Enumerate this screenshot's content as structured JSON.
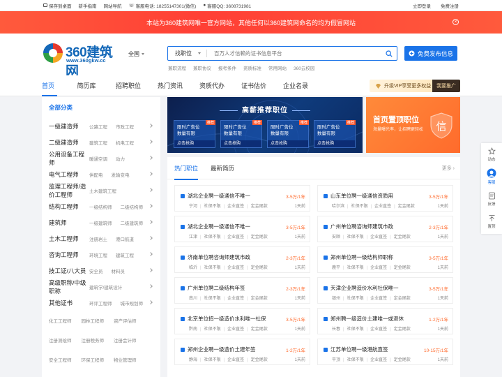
{
  "topbar": {
    "save_desktop": "保存到桌面",
    "newbie": "新手指南",
    "site_nav": "网站导航",
    "service_phone": "客服电话: 18255147301(微信)",
    "service_qq": "客服QQ: 3608731981",
    "login": "立即登录",
    "register": "免费注册"
  },
  "banner": {
    "text": "本站为360建筑网唯一官方网站，其他任何以360建筑网命名的均为假冒网站",
    "close": "×"
  },
  "header": {
    "logo_text": "360建筑网",
    "logo_sub": "www.360gkw.cc",
    "city": "全国",
    "search_select": "找职位",
    "search_placeholder": "百万人才信赖的证书信息平台",
    "publish_label": "免费发布信息",
    "hotlinks": [
      "兼职流程",
      "兼职协议",
      "报考条件",
      "资质标准",
      "常用网站",
      "360云校园"
    ]
  },
  "nav": {
    "items": [
      "首页",
      "简历库",
      "招聘职位",
      "热门资讯",
      "资质代办",
      "证书估价",
      "企业名录"
    ],
    "vip_text": "升级VIP享受更多权益",
    "vip_button": "我要推广"
  },
  "categories": {
    "title": "全部分类",
    "rows": [
      {
        "main": "一级建造师",
        "subs": [
          "公路工程",
          "市政工程"
        ]
      },
      {
        "main": "二级建造师",
        "subs": [
          "建筑工程",
          "机电工程"
        ]
      },
      {
        "main": "公用设备工程师",
        "subs": [
          "暖通空调",
          "动力"
        ]
      },
      {
        "main": "电气工程师",
        "subs": [
          "供配电",
          "发输变电"
        ]
      },
      {
        "main": "监理工程师/造价工程师",
        "subs": [
          "土木建筑工程"
        ]
      },
      {
        "main": "结构工程师",
        "subs": [
          "一级结构师",
          "二级结构师"
        ]
      },
      {
        "main": "建筑师",
        "subs": [
          "一级建筑师",
          "二级建筑师"
        ]
      },
      {
        "main": "土木工程师",
        "subs": [
          "注册岩土",
          "港口航道"
        ]
      },
      {
        "main": "咨询工程师",
        "subs": [
          "环境工程",
          "建筑工程"
        ]
      },
      {
        "main": "技工证/八大员",
        "subs": [
          "安全员",
          "材料员"
        ]
      },
      {
        "main": "高级职称/中级职称",
        "subs": [
          "建筑学/建筑设计"
        ]
      },
      {
        "main": "其他证书",
        "subs": [
          "环评工程师",
          "城市规划师"
        ]
      }
    ],
    "extra_rows": [
      [
        "化工工程师",
        "园林工程师",
        "资产评估师"
      ],
      [
        "注册测绘师",
        "注册税务师",
        "注册会计师"
      ],
      [
        "安全工程师",
        "环保工程师",
        "物业管理师"
      ]
    ]
  },
  "promo": {
    "title": "高薪推荐职位",
    "cards": [
      {
        "line1": "限时广告位",
        "line2": "数量有限",
        "btn": "点击抢购",
        "tag": "推荐"
      },
      {
        "line1": "限时广告位",
        "line2": "数量有限",
        "btn": "点击抢购",
        "tag": "推荐"
      },
      {
        "line1": "限时广告位",
        "line2": "数量有限",
        "btn": "点击抢购",
        "tag": "推荐"
      },
      {
        "line1": "限时广告位",
        "line2": "数量有限",
        "btn": "点击抢购",
        "tag": "推荐"
      }
    ],
    "top_title": "首页置顶职位",
    "top_sub": "海量曝光率，让招聘更轻松",
    "top_badge": "信"
  },
  "jobs": {
    "tab_hot": "热门职位",
    "tab_new": "最新简历",
    "more": "更多 ›",
    "list": [
      {
        "title": "湖北企业聘一级通信不唯一",
        "salary": "3-5万/1年",
        "meta": [
          "宁河",
          "社保不限",
          "企业直签",
          "定金尾款"
        ],
        "date": "1天前"
      },
      {
        "title": "山东单位聘一级通信资质用",
        "salary": "3-5万/1年",
        "meta": [
          "哈尔滨",
          "社保不限",
          "企业直签",
          "定金尾款"
        ],
        "date": "1天前"
      },
      {
        "title": "湖北企业聘一级通信不唯一",
        "salary": "3-5万/1年",
        "meta": [
          "江津",
          "社保不限",
          "企业直签",
          "定金尾款"
        ],
        "date": "1天前"
      },
      {
        "title": "广州单位聘咨询师建筑市政",
        "salary": "2-3万/1年",
        "meta": [
          "安顺",
          "社保不限",
          "企业直签",
          "定金尾款"
        ],
        "date": "1天前"
      },
      {
        "title": "济南单位聘咨询师建筑市政",
        "salary": "2-3万/1年",
        "meta": [
          "临沂",
          "社保不限",
          "企业直签",
          "定金尾款"
        ],
        "date": "1天前"
      },
      {
        "title": "郑州单位聘一级结构师职称",
        "salary": "3-5万/1年",
        "meta": [
          "鹿平",
          "社保不限",
          "企业直签",
          "定金尾款"
        ],
        "date": "1天前"
      },
      {
        "title": "广州单位聘二级结构年签",
        "salary": "2-3万/1年",
        "meta": [
          "南川",
          "社保不限",
          "企业直签",
          "定金尾款"
        ],
        "date": "1天前"
      },
      {
        "title": "天津企业聘造价水利社保唯一",
        "salary": "3-5万/1年",
        "meta": [
          "银州",
          "社保不限",
          "企业直签",
          "定金尾款"
        ],
        "date": "1天前"
      },
      {
        "title": "北京单位招一级造价水利唯一社保",
        "salary": "3-5万/1年",
        "meta": [
          "黔南",
          "社保不限",
          "企业直签",
          "定金尾款"
        ],
        "date": "1天前"
      },
      {
        "title": "郑州聘一级造价土建唯一或退休",
        "salary": "1-2万/1年",
        "meta": [
          "长春",
          "社保不限",
          "企业直签",
          "定金尾款"
        ],
        "date": "1天前"
      },
      {
        "title": "郑州企业聘一级造价土建年签",
        "salary": "1-2万/1年",
        "meta": [
          "静海",
          "社保不限",
          "企业直签",
          "定金尾款"
        ],
        "date": "1天前"
      },
      {
        "title": "江苏单位聘一级港航直签",
        "salary": "10-15万/1年",
        "meta": [
          "平顶",
          "社保不限",
          "企业直签",
          "定金尾款"
        ],
        "date": "1天前"
      }
    ]
  },
  "float": {
    "items": [
      "动态",
      "客服",
      "反馈",
      "置顶"
    ],
    "icons": [
      "star-icon",
      "service-avatar-icon",
      "feedback-icon",
      "back-to-top-icon"
    ]
  },
  "colors": {
    "accent": "#1a73e8",
    "banner": "#ff4b38",
    "salary": "#ff6a2c"
  }
}
